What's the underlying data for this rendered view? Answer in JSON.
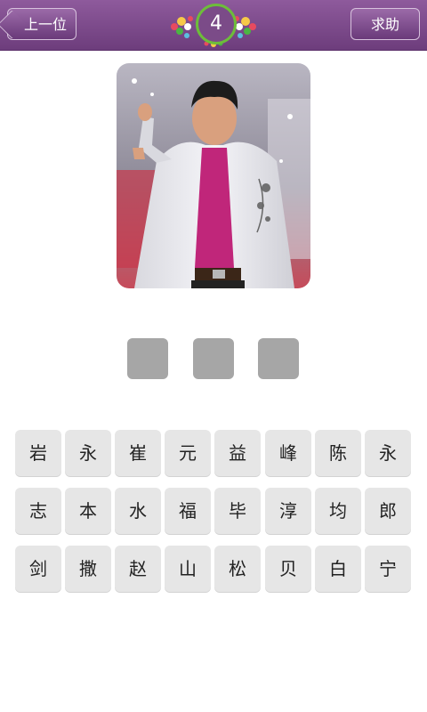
{
  "header": {
    "back_label": "上一位",
    "level": "4",
    "help_label": "求助"
  },
  "answer_slots": [
    "",
    "",
    ""
  ],
  "keyboard": [
    [
      "岩",
      "永",
      "崔",
      "元",
      "益",
      "峰",
      "陈",
      "永"
    ],
    [
      "志",
      "本",
      "水",
      "福",
      "毕",
      "淳",
      "均",
      "郎"
    ],
    [
      "剑",
      "撒",
      "赵",
      "山",
      "松",
      "贝",
      "白",
      "宁"
    ]
  ],
  "colors": {
    "header_top": "#8e5a9c",
    "header_bottom": "#6d3d7c",
    "slot": "#a6a6a6",
    "key_bg": "#e6e6e6"
  }
}
